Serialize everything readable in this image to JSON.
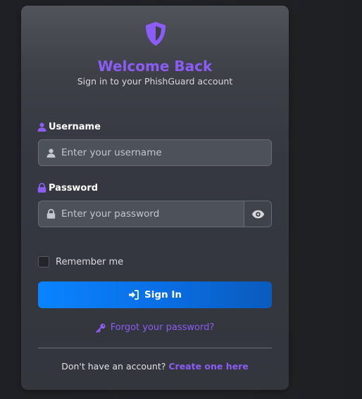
{
  "colors": {
    "accent": "#8b5cf6",
    "primary_button": "#0a84ff",
    "card_background": "#353840",
    "page_background": "#1f2126"
  },
  "logo": {
    "icon": "shield-icon"
  },
  "header": {
    "title": "Welcome Back",
    "subtitle": "Sign in to your PhishGuard account"
  },
  "form": {
    "username": {
      "label": "Username",
      "label_icon": "user-icon",
      "field_icon": "user-icon",
      "placeholder": "Enter your username",
      "value": ""
    },
    "password": {
      "label": "Password",
      "label_icon": "lock-icon",
      "field_icon": "lock-icon",
      "placeholder": "Enter your password",
      "value": "",
      "toggle_icon": "eye-icon"
    },
    "remember": {
      "label": "Remember me",
      "checked": false
    },
    "submit": {
      "label": "Sign In",
      "icon": "sign-in-icon"
    },
    "forgot": {
      "label": "Forgot your password?",
      "icon": "key-icon"
    }
  },
  "footer": {
    "prompt": "Don't have an account?",
    "link": "Create one here"
  }
}
